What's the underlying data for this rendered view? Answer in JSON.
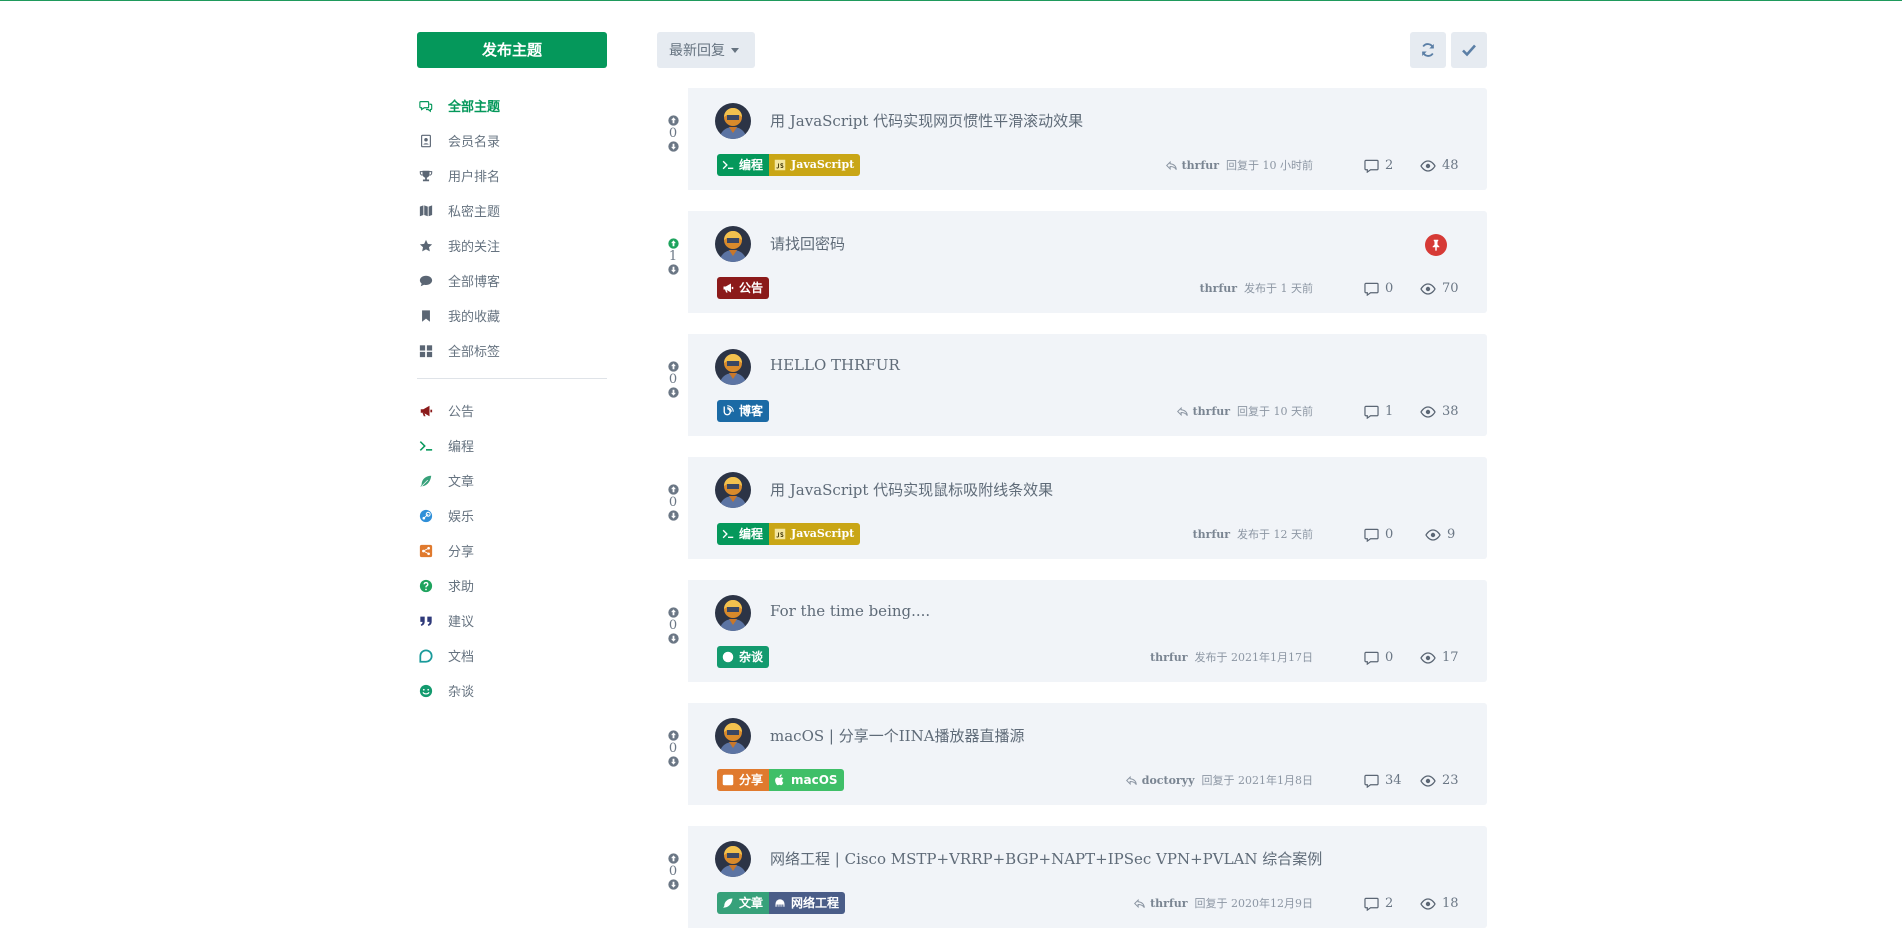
{
  "sidebar": {
    "new_topic": "发布主题",
    "items": [
      {
        "label": "全部主题",
        "icon": "comments-icon",
        "active": true
      },
      {
        "label": "会员名录",
        "icon": "address-book-icon"
      },
      {
        "label": "用户排名",
        "icon": "trophy-icon"
      },
      {
        "label": "私密主题",
        "icon": "map-icon"
      },
      {
        "label": "我的关注",
        "icon": "star-icon"
      },
      {
        "label": "全部博客",
        "icon": "comment-icon"
      },
      {
        "label": "我的收藏",
        "icon": "bookmark-icon"
      },
      {
        "label": "全部标签",
        "icon": "th-large-icon"
      }
    ],
    "tags": [
      {
        "label": "公告",
        "icon": "bullhorn-icon",
        "color": "#8b1a1a"
      },
      {
        "label": "编程",
        "icon": "terminal-icon",
        "color": "#05985b"
      },
      {
        "label": "文章",
        "icon": "feather-icon",
        "color": "#37a17a"
      },
      {
        "label": "娱乐",
        "icon": "steam-icon",
        "color": "#2f8fd8"
      },
      {
        "label": "分享",
        "icon": "share-icon",
        "color": "#e07a2e"
      },
      {
        "label": "求助",
        "icon": "question-icon",
        "color": "#1ea35d"
      },
      {
        "label": "建议",
        "icon": "quote-icon",
        "color": "#2f3a7a"
      },
      {
        "label": "文档",
        "icon": "chat-icon",
        "color": "#1a9a9a"
      },
      {
        "label": "杂谈",
        "icon": "smile-icon",
        "color": "#139a6e"
      }
    ]
  },
  "toolbar": {
    "sort_label": "最新回复",
    "refresh_icon": "refresh-icon",
    "mark_read_icon": "check-icon"
  },
  "discussions": [
    {
      "title": "用 JavaScript 代码实现网页惯性平滑滚动效果",
      "votes": "0",
      "tags": [
        {
          "label": "编程",
          "icon": "terminal-icon",
          "color": "#05985b"
        },
        {
          "label": "JavaScript",
          "icon": "js-icon",
          "color": "#c9a616"
        }
      ],
      "user": "thrfur",
      "action": "回复于 10 小时前",
      "reply": true,
      "comments": "2",
      "views": "48",
      "pinned": false
    },
    {
      "title": "请找回密码",
      "votes": "1",
      "tags": [
        {
          "label": "公告",
          "icon": "bullhorn-icon",
          "color": "#8b1a1a"
        }
      ],
      "user": "thrfur",
      "action": "发布于 1 天前",
      "reply": false,
      "comments": "0",
      "views": "70",
      "pinned": true
    },
    {
      "title": "HELLO THRFUR",
      "votes": "0",
      "tags": [
        {
          "label": "博客",
          "icon": "blog-icon",
          "color": "#1b6aa5"
        }
      ],
      "user": "thrfur",
      "action": "回复于 10 天前",
      "reply": true,
      "comments": "1",
      "views": "38",
      "pinned": false
    },
    {
      "title": "用 JavaScript 代码实现鼠标吸附线条效果",
      "votes": "0",
      "tags": [
        {
          "label": "编程",
          "icon": "terminal-icon",
          "color": "#05985b"
        },
        {
          "label": "JavaScript",
          "icon": "js-icon",
          "color": "#c9a616"
        }
      ],
      "user": "thrfur",
      "action": "发布于 12 天前",
      "reply": false,
      "comments": "0",
      "views": "9",
      "pinned": false
    },
    {
      "title": "For the time being....",
      "votes": "0",
      "tags": [
        {
          "label": "杂谈",
          "icon": "smile-icon",
          "color": "#139a6e"
        }
      ],
      "user": "thrfur",
      "action": "发布于 2021年1月17日",
      "reply": false,
      "comments": "0",
      "views": "17",
      "pinned": false
    },
    {
      "title": "macOS | 分享一个IINA播放器直播源",
      "votes": "0",
      "tags": [
        {
          "label": "分享",
          "icon": "share-icon",
          "color": "#e07a2e"
        },
        {
          "label": "macOS",
          "icon": "apple-icon",
          "color": "#3fbf68"
        }
      ],
      "user": "doctoryy",
      "action": "回复于 2021年1月8日",
      "reply": true,
      "comments": "34",
      "views": "23",
      "pinned": false
    },
    {
      "title": "网络工程 | Cisco MSTP+VRRP+BGP+NAPT+IPSec VPN+PVLAN 综合案例",
      "votes": "0",
      "tags": [
        {
          "label": "文章",
          "icon": "feather-icon",
          "color": "#37a17a"
        },
        {
          "label": "网络工程",
          "icon": "network-icon",
          "color": "#4a5d88"
        }
      ],
      "user": "thrfur",
      "action": "回复于 2020年12月9日",
      "reply": true,
      "comments": "2",
      "views": "18",
      "pinned": false
    }
  ]
}
